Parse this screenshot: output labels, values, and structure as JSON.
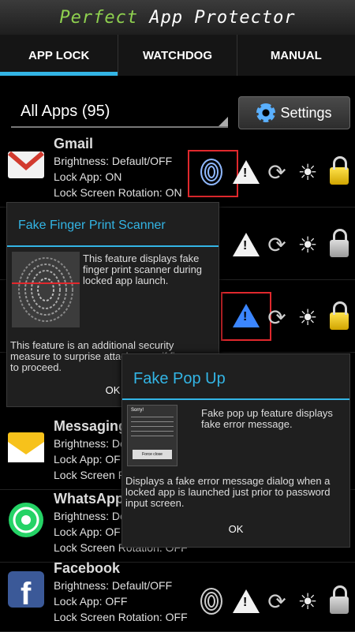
{
  "header": {
    "title_part1": "Perfect",
    "title_part2": "App Protector"
  },
  "tabs": [
    {
      "label": "APP LOCK",
      "active": true
    },
    {
      "label": "WATCHDOG",
      "active": false
    },
    {
      "label": "MANUAL",
      "active": false
    }
  ],
  "filter": {
    "label": "All Apps (95)",
    "settings_label": "Settings"
  },
  "apps": [
    {
      "name": "Gmail",
      "brightness": "Brightness: Default/OFF",
      "lock": "Lock App: ON",
      "rotation": "Lock Screen Rotation: ON"
    },
    {
      "name": "Messaging",
      "brightness": "Brightness: De",
      "lock": "Lock App: OFF",
      "rotation": "Lock Screen Ro"
    },
    {
      "name": "WhatsApp",
      "brightness": "Brightness: De",
      "lock": "Lock App: OFF",
      "rotation": "Lock Screen Rotation: OFF"
    },
    {
      "name": "Facebook",
      "brightness": "Brightness: Default/OFF",
      "lock": "Lock App: OFF",
      "rotation": "Lock Screen Rotation: OFF"
    }
  ],
  "dialog_fingerprint": {
    "title": "Fake Finger Print Scanner",
    "desc": "This feature displays fake finger print scanner during locked app launch.",
    "detail": "This feature is an additional security measure to surprise attackers as if fi",
    "detail_end": "to proceed.",
    "ok": "OK"
  },
  "dialog_popup": {
    "title": "Fake Pop Up",
    "desc": "Fake pop up feature displays fake error message.",
    "detail": "Displays a fake error message dialog when a locked app is launched just prior to password input screen.",
    "ok": "OK",
    "thumb_title": "Sorry!",
    "thumb_button": "Force close"
  },
  "colors": {
    "accent": "#33b5e5",
    "highlight": "#e0282d",
    "title_green": "#8fd14f"
  }
}
